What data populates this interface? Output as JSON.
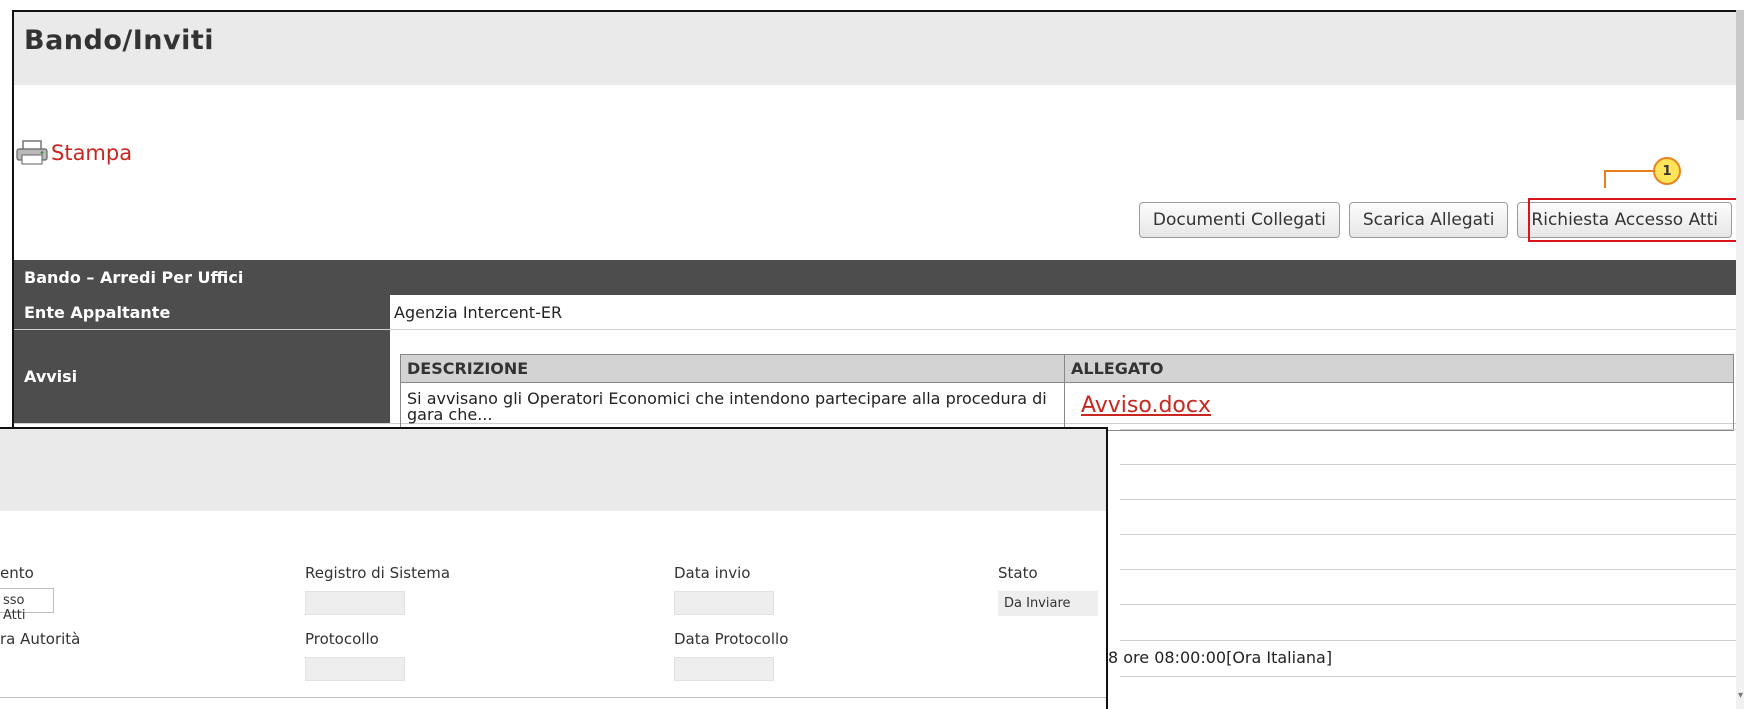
{
  "main": {
    "title": "Bando/Inviti",
    "stampa_label": "Stampa",
    "buttons": {
      "documenti_collegati": "Documenti Collegati",
      "scarica_allegati": "Scarica Allegati",
      "richiesta_accesso_atti": "Richiesta Accesso Atti"
    },
    "callout_number": "1",
    "section_title": "Bando – Arredi Per Uffici",
    "ente_label": "Ente Appaltante",
    "ente_value": "Agenzia Intercent-ER",
    "avvisi_label": "Avvisi",
    "avvisi_table": {
      "headers": [
        "DESCRIZIONE",
        "ALLEGATO"
      ],
      "rows": [
        {
          "descrizione": "Si avvisano gli Operatori Economici che intendono partecipare alla procedura di gara che...",
          "allegato": "Avviso.docx"
        }
      ]
    },
    "partial_date_text": "8 ore 08:00:00[Ora Italiana]"
  },
  "front": {
    "label_documento": "ento",
    "value_documento": "sso Atti",
    "label_registro": "Registro di Sistema",
    "label_data_invio": "Data invio",
    "label_stato": "Stato",
    "value_stato": "Da Inviare",
    "label_autorita": "ra Autorità",
    "label_protocollo": "Protocollo",
    "label_data_protocollo": "Data Protocollo"
  },
  "colors": {
    "accent_red": "#c8261e",
    "highlight_red": "#d9151b",
    "callout_orange": "#e97d1d",
    "callout_fill": "#ffe45a",
    "header_dark": "#4d4d4d"
  }
}
